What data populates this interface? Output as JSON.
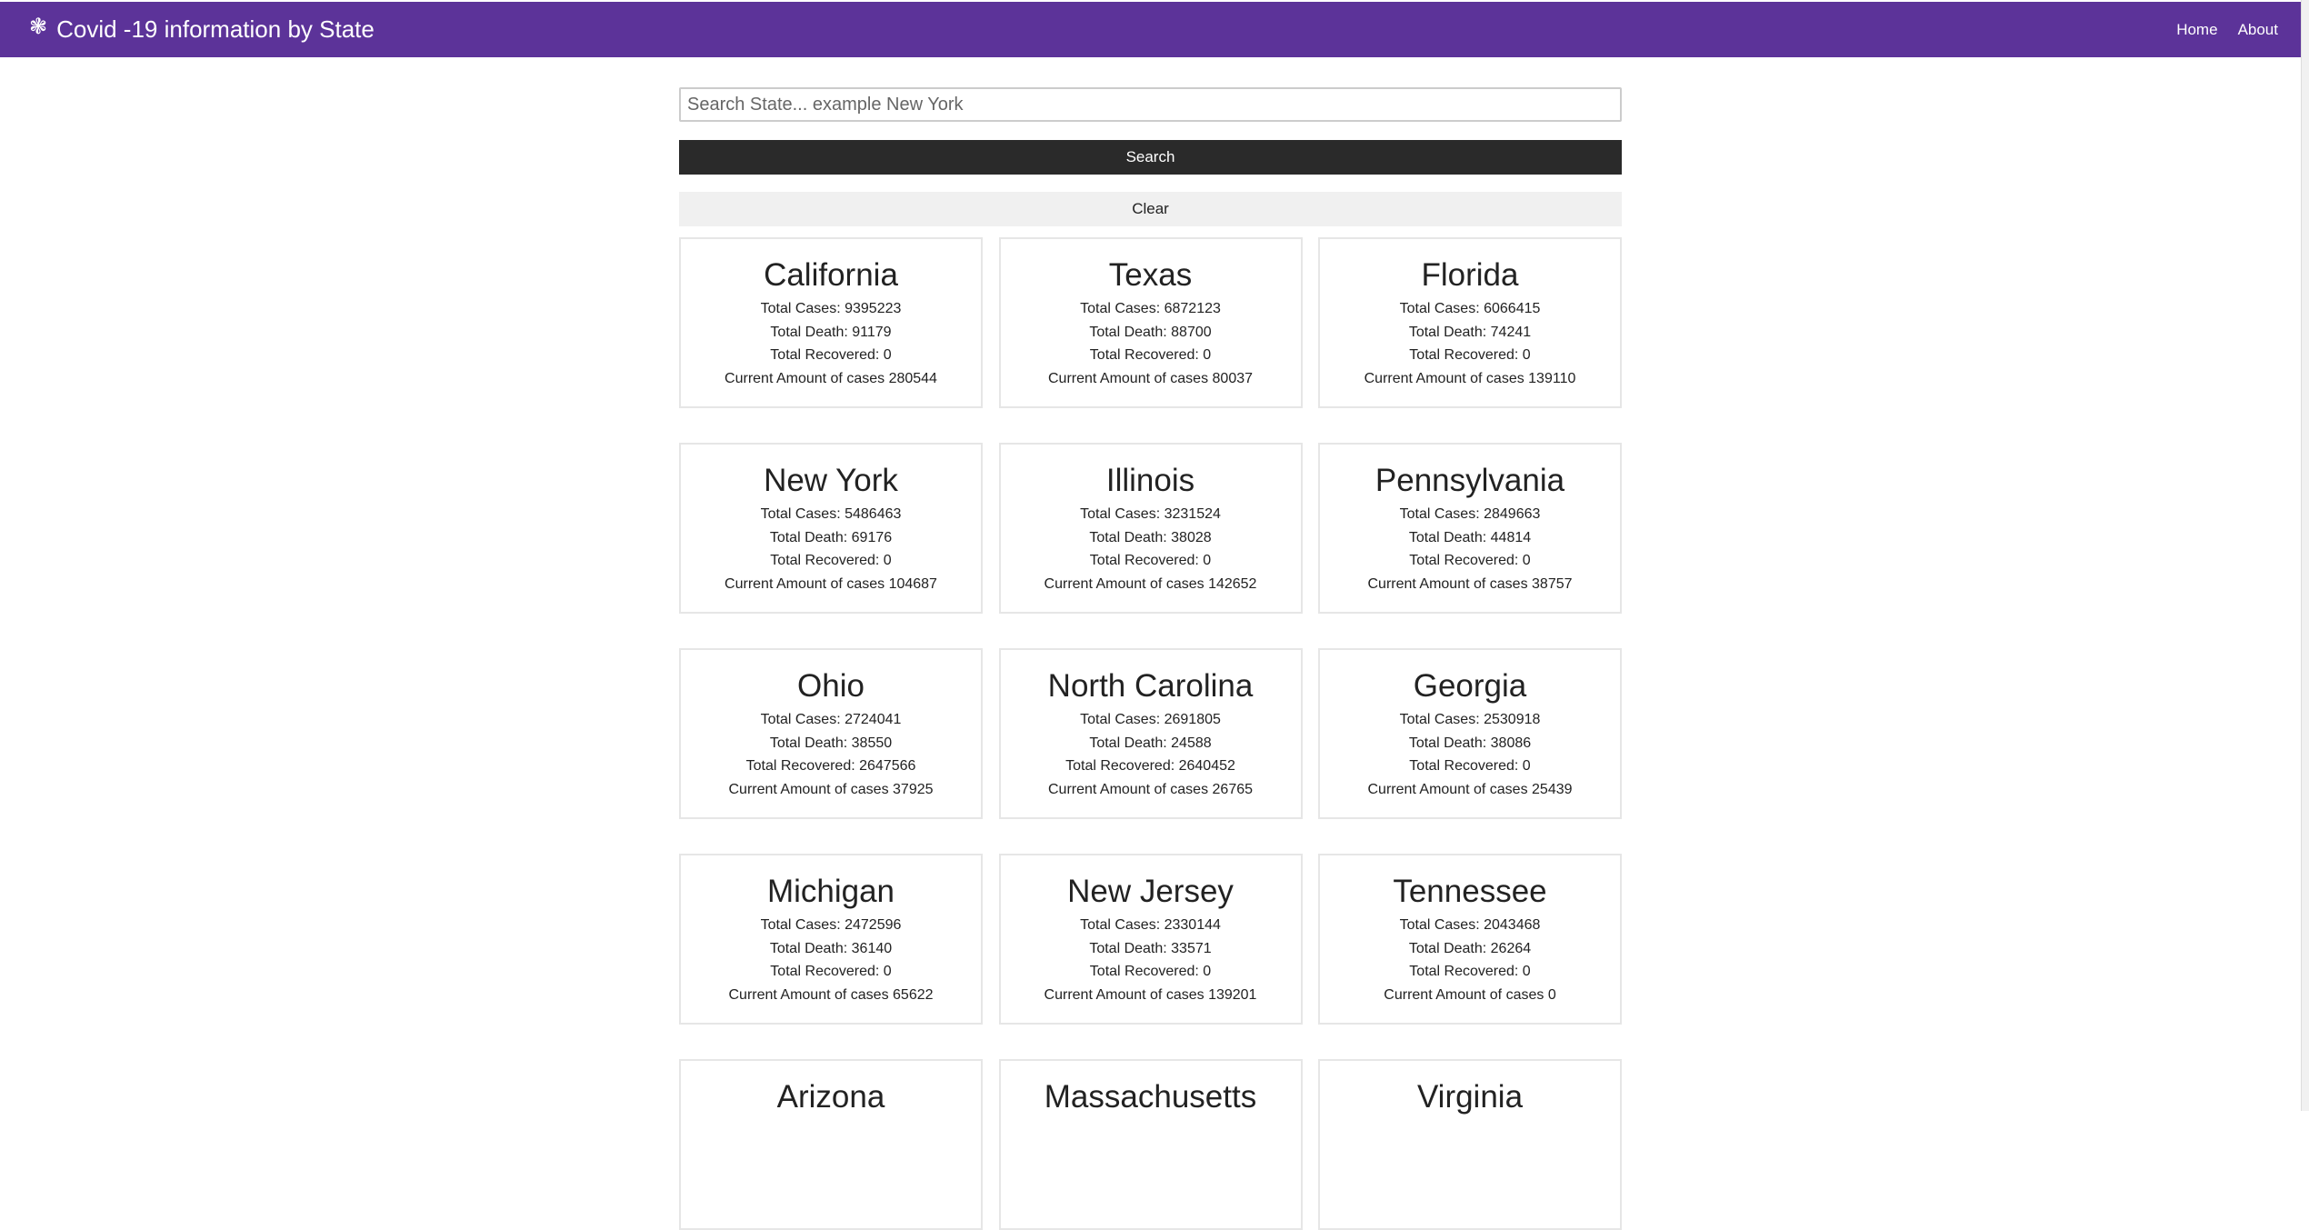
{
  "header": {
    "icon": "virus-icon",
    "title": "Covid -19 information by State",
    "nav": [
      {
        "label": "Home"
      },
      {
        "label": "About"
      }
    ]
  },
  "search": {
    "placeholder": "Search State... example New York",
    "value": "",
    "search_label": "Search",
    "clear_label": "Clear"
  },
  "states": [
    {
      "name": "California",
      "cases": "Total Cases: 9395223",
      "death": "Total Death: 91179",
      "recovered": "Total Recovered: 0",
      "current": "Current Amount of cases 280544"
    },
    {
      "name": "Texas",
      "cases": "Total Cases: 6872123",
      "death": "Total Death: 88700",
      "recovered": "Total Recovered: 0",
      "current": "Current Amount of cases 80037"
    },
    {
      "name": "Florida",
      "cases": "Total Cases: 6066415",
      "death": "Total Death: 74241",
      "recovered": "Total Recovered: 0",
      "current": "Current Amount of cases 139110"
    },
    {
      "name": "New York",
      "cases": "Total Cases: 5486463",
      "death": "Total Death: 69176",
      "recovered": "Total Recovered: 0",
      "current": "Current Amount of cases 104687"
    },
    {
      "name": "Illinois",
      "cases": "Total Cases: 3231524",
      "death": "Total Death: 38028",
      "recovered": "Total Recovered: 0",
      "current": "Current Amount of cases 142652"
    },
    {
      "name": "Pennsylvania",
      "cases": "Total Cases: 2849663",
      "death": "Total Death: 44814",
      "recovered": "Total Recovered: 0",
      "current": "Current Amount of cases 38757"
    },
    {
      "name": "Ohio",
      "cases": "Total Cases: 2724041",
      "death": "Total Death: 38550",
      "recovered": "Total Recovered: 2647566",
      "current": "Current Amount of cases 37925"
    },
    {
      "name": "North Carolina",
      "cases": "Total Cases: 2691805",
      "death": "Total Death: 24588",
      "recovered": "Total Recovered: 2640452",
      "current": "Current Amount of cases 26765"
    },
    {
      "name": "Georgia",
      "cases": "Total Cases: 2530918",
      "death": "Total Death: 38086",
      "recovered": "Total Recovered: 0",
      "current": "Current Amount of cases 25439"
    },
    {
      "name": "Michigan",
      "cases": "Total Cases: 2472596",
      "death": "Total Death: 36140",
      "recovered": "Total Recovered: 0",
      "current": "Current Amount of cases 65622"
    },
    {
      "name": "New Jersey",
      "cases": "Total Cases: 2330144",
      "death": "Total Death: 33571",
      "recovered": "Total Recovered: 0",
      "current": "Current Amount of cases 139201"
    },
    {
      "name": "Tennessee",
      "cases": "Total Cases: 2043468",
      "death": "Total Death: 26264",
      "recovered": "Total Recovered: 0",
      "current": "Current Amount of cases 0"
    },
    {
      "name": "Arizona"
    },
    {
      "name": "Massachusetts"
    },
    {
      "name": "Virginia"
    }
  ],
  "colors": {
    "navbar": "#5c3399",
    "search_button": "#2a2a2a",
    "clear_button": "#f0f0f0"
  }
}
